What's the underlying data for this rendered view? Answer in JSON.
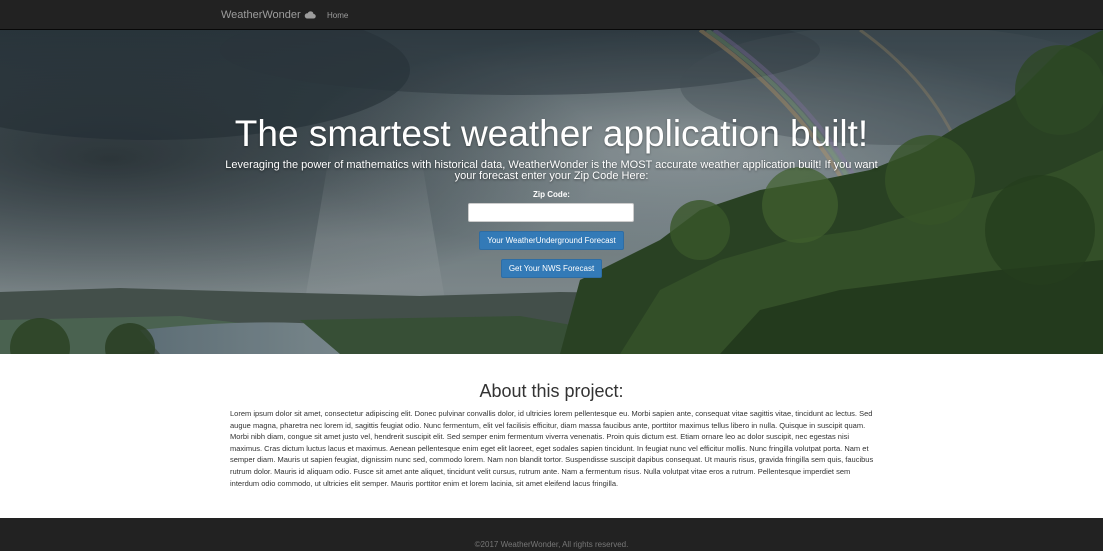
{
  "navbar": {
    "brand": "WeatherWonder",
    "brand_icon": "cloud-icon",
    "home_label": "Home"
  },
  "hero": {
    "title": "The smartest weather application built!",
    "lead": "Leveraging the power of mathematics with historical data, WeatherWonder is the MOST accurate weather application built! If you want your forecast enter your Zip Code Here:",
    "zip_label": "Zip Code:",
    "zip_value": "",
    "zip_placeholder": "",
    "wu_button": "Your WeatherUnderground Forecast",
    "nws_button": "Get Your NWS Forecast"
  },
  "about": {
    "title": "About this project:",
    "body": "Lorem ipsum dolor sit amet, consectetur adipiscing elit. Donec pulvinar convallis dolor, id ultricies lorem pellentesque eu. Morbi sapien ante, consequat vitae sagittis vitae, tincidunt ac lectus. Sed augue magna, pharetra nec lorem id, sagittis feugiat odio. Nunc fermentum, elit vel facilisis efficitur, diam massa faucibus ante, porttitor maximus tellus libero in nulla. Quisque in suscipit quam. Morbi nibh diam, congue sit amet justo vel, hendrerit suscipit elit. Sed semper enim fermentum viverra venenatis. Proin quis dictum est. Etiam ornare leo ac dolor suscipit, nec egestas nisi maximus. Cras dictum luctus lacus et maximus. Aenean pellentesque enim eget elit laoreet, eget sodales sapien tincidunt. In feugiat nunc vel efficitur mollis. Nunc fringilla volutpat porta. Nam et semper diam. Mauris ut sapien feugiat, dignissim nunc sed, commodo lorem. Nam non blandit tortor. Suspendisse suscipit dapibus consequat. Ut mauris risus, gravida fringilla sem quis, faucibus rutrum dolor. Mauris id aliquam odio. Fusce sit amet ante aliquet, tincidunt velit cursus, rutrum ante. Nam a fermentum risus. Nulla volutpat vitae eros a rutrum. Pellentesque imperdiet sem interdum odio commodo, ut ultricies elit semper. Mauris porttitor enim et lorem lacinia, sit amet eleifend lacus fringilla."
  },
  "footer": {
    "text": "©2017 WeatherWonder, All rights reserved."
  },
  "colors": {
    "navbar_bg": "#222222",
    "button_primary": "#337ab7",
    "footer_bg": "#222222",
    "footer_text": "#777777"
  }
}
